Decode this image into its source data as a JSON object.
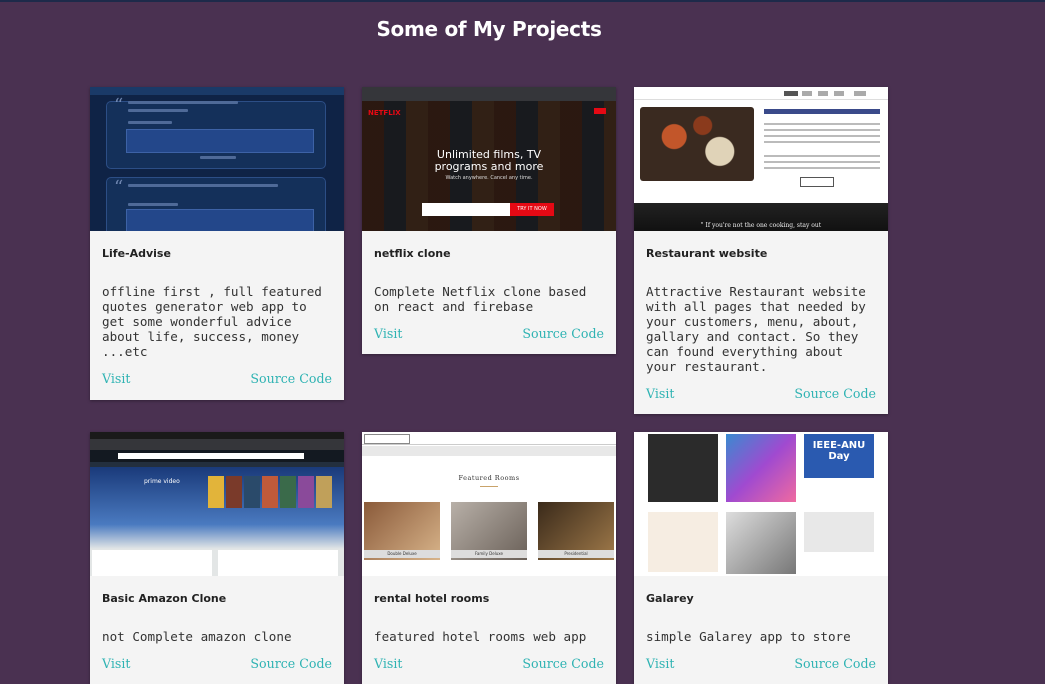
{
  "heading": "Some of My Projects",
  "projects": [
    {
      "name": "Life-Advise",
      "description": "offline first , full featured quotes generator web app to get some wonderful advice about life, success, money ...etc",
      "visit_label": "Visit",
      "source_label": "Source Code",
      "thumbnail": "life-advise-screenshot"
    },
    {
      "name": "netflix clone",
      "description": "Complete Netflix clone based on react and firebase",
      "visit_label": "Visit",
      "source_label": "Source Code",
      "thumbnail": "netflix-clone-screenshot",
      "thumb_text": {
        "logo": "NETFLIX",
        "headline": "Unlimited films, TV programs and more",
        "sub": "Watch anywhere. Cancel any time.",
        "cta": "TRY IT NOW"
      }
    },
    {
      "name": "Restaurant website",
      "description": "Attractive Restaurant website with all pages that needed by your customers, menu, about, gallary and contact. So they can found everything about your restaurant.",
      "visit_label": "Visit",
      "source_label": "Source Code",
      "thumbnail": "restaurant-website-screenshot",
      "thumb_text": {
        "quote": "\" If you're not the one cooking, stay out"
      }
    },
    {
      "name": "Basic Amazon Clone",
      "description": "not Complete amazon clone",
      "visit_label": "Visit",
      "source_label": "Source Code",
      "thumbnail": "amazon-clone-screenshot",
      "thumb_text": {
        "prime": "prime video"
      }
    },
    {
      "name": "rental hotel rooms",
      "description": "featured hotel rooms web app",
      "visit_label": "Visit",
      "source_label": "Source Code",
      "thumbnail": "hotel-rooms-screenshot",
      "thumb_text": {
        "title": "Featured Rooms",
        "rooms": [
          "Double Deluxe",
          "Family Deluxe",
          "Presidential"
        ]
      }
    },
    {
      "name": "Galarey",
      "description": "simple Galarey app to store",
      "visit_label": "Visit",
      "source_label": "Source Code",
      "thumbnail": "galarey-screenshot",
      "thumb_text": {
        "ieee": "IEEE-ANU Day"
      }
    }
  ],
  "colors": {
    "background": "#4a3151",
    "card": "#f4f4f4",
    "link": "#2fb3b3"
  }
}
